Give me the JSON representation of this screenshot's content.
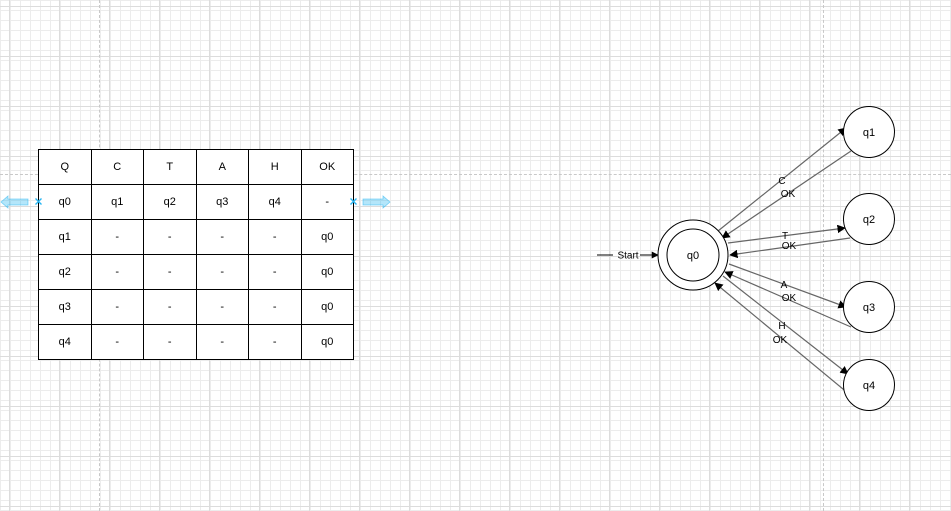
{
  "table": {
    "header": [
      "Q",
      "C",
      "T",
      "A",
      "H",
      "OK"
    ],
    "rows": [
      [
        "q0",
        "q1",
        "q2",
        "q3",
        "q4",
        "-"
      ],
      [
        "q1",
        "-",
        "-",
        "-",
        "-",
        "q0"
      ],
      [
        "q2",
        "-",
        "-",
        "-",
        "-",
        "q0"
      ],
      [
        "q3",
        "-",
        "-",
        "-",
        "-",
        "q0"
      ],
      [
        "q4",
        "-",
        "-",
        "-",
        "-",
        "q0"
      ]
    ]
  },
  "automaton": {
    "start_label": "Start",
    "states": {
      "q0": "q0",
      "q1": "q1",
      "q2": "q2",
      "q3": "q3",
      "q4": "q4"
    },
    "accepting_state": "q0",
    "transitions": [
      {
        "from": "q0",
        "to": "q1",
        "label": "C"
      },
      {
        "from": "q1",
        "to": "q0",
        "label": "OK"
      },
      {
        "from": "q0",
        "to": "q2",
        "label": "T"
      },
      {
        "from": "q2",
        "to": "q0",
        "label": "OK"
      },
      {
        "from": "q0",
        "to": "q3",
        "label": "A"
      },
      {
        "from": "q3",
        "to": "q0",
        "label": "OK"
      },
      {
        "from": "q0",
        "to": "q4",
        "label": "H"
      },
      {
        "from": "q4",
        "to": "q0",
        "label": "OK"
      }
    ]
  },
  "colors": {
    "edge": "#666666",
    "stroke": "#000000",
    "selection": "#29b6f2"
  }
}
